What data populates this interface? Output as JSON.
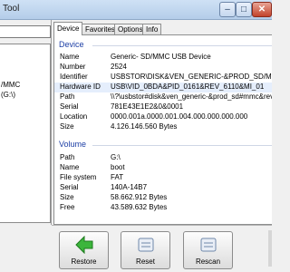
{
  "window": {
    "title": "Tool"
  },
  "left_pane": {
    "lines": [
      "/MMC",
      "(G:\\)"
    ]
  },
  "tabs": [
    {
      "label": "Device"
    },
    {
      "label": "Favorites"
    },
    {
      "label": "Options"
    },
    {
      "label": "Info"
    }
  ],
  "device": {
    "heading": "Device",
    "rows": [
      {
        "label": "Name",
        "value": "Generic- SD/MMC USB Device"
      },
      {
        "label": "Number",
        "value": "2524"
      },
      {
        "label": "Identifier",
        "value": "USBSTOR\\DISK&VEN_GENERIC-&PROD_SD/MMC&R"
      },
      {
        "label": "Hardware ID",
        "value": "USB\\VID_0BDA&PID_0161&REV_6110&MI_01"
      },
      {
        "label": "Path",
        "value": "\\\\?\\usbstor#disk&ven_generic-&prod_sd#mmc&rev_1.0"
      },
      {
        "label": "Serial",
        "value": "781E43E1E2&0&0001"
      },
      {
        "label": "Location",
        "value": "0000.001a.0000.001.004.000.000.000.000"
      },
      {
        "label": "Size",
        "value": "4.126.146.560 Bytes"
      }
    ]
  },
  "volume": {
    "heading": "Volume",
    "rows": [
      {
        "label": "Path",
        "value": "G:\\"
      },
      {
        "label": "Name",
        "value": "boot"
      },
      {
        "label": "File system",
        "value": "FAT"
      },
      {
        "label": "Serial",
        "value": "140A-14B7"
      },
      {
        "label": "Size",
        "value": "58.662.912 Bytes"
      },
      {
        "label": "Free",
        "value": "43.589.632 Bytes"
      }
    ]
  },
  "actions": {
    "restore": "Restore",
    "reset": "Reset",
    "rescan": "Rescan"
  },
  "colors": {
    "accent": "#1c3ea5",
    "selected_row": "#e5eefc"
  },
  "icons": [
    "restore-arrow-icon",
    "reset-icon",
    "rescan-icon",
    "close-icon",
    "minimize-icon",
    "maximize-icon"
  ]
}
